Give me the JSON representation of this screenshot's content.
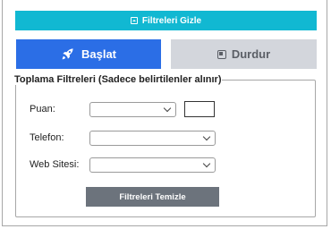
{
  "filter_toggle": {
    "label": "Filtreleri Gizle"
  },
  "actions": {
    "start_label": "Başlat",
    "stop_label": "Durdur"
  },
  "filters": {
    "legend": "Toplama Filtreleri (Sadece belirtilenler alınır)",
    "rows": [
      {
        "label": "Puan:",
        "value": ""
      },
      {
        "label": "Telefon:",
        "value": ""
      },
      {
        "label": "Web Sitesi:",
        "value": ""
      }
    ],
    "clear_label": "Filtreleri Temizle"
  },
  "colors": {
    "toggle": "#11b8d2",
    "start": "#2b6ee6",
    "stop": "#d3d6dc",
    "clear": "#6c737c"
  },
  "icons": {
    "toggle": "collapse-icon",
    "start": "rocket-icon",
    "stop": "stop-icon",
    "select": "chevron-down-icon"
  }
}
